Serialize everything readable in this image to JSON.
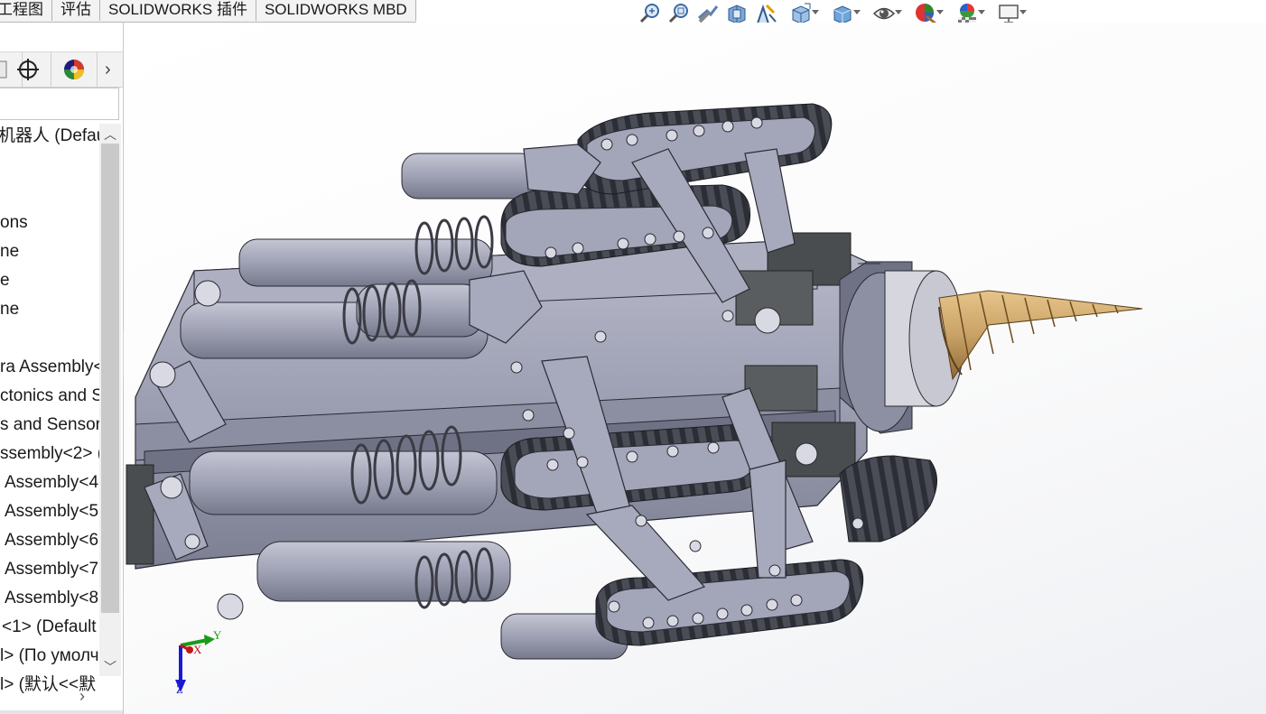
{
  "command_tabs": [
    "工程图",
    "评估",
    "SOLIDWORKS 插件",
    "SOLIDWORKS MBD"
  ],
  "hud_toolbar": {
    "icons": [
      "zoom-to-fit-icon",
      "zoom-to-area-icon",
      "previous-view-icon",
      "section-view-icon",
      "dynamic-annotation-icon",
      "view-orientation-icon",
      "display-style-icon",
      "hide-show-icon",
      "edit-appearance-icon",
      "apply-scene-icon",
      "view-settings-icon"
    ]
  },
  "panel": {
    "tabs": [
      "property-manager-tab",
      "dimxpert-tab",
      "display-manager-tab"
    ],
    "tree_items": [
      "机器人  (Defau",
      "ons",
      "ne",
      "e",
      "ne",
      "ra Assembly<",
      "ctonics and S",
      "s and Sensor",
      "ssembly<2> (",
      "Assembly<4",
      "Assembly<5",
      "Assembly<6",
      "Assembly<7",
      "Assembly<8",
      "<1> (Default",
      "l> (По умолч",
      "l> (默认<<默"
    ]
  },
  "triad": {
    "x_label": "X",
    "y_label": "Y",
    "z_label": "Z"
  },
  "colors": {
    "metal": "#9a9caf",
    "metal_dark": "#6e7085",
    "drill_bit": "#c8a46a",
    "track": "#3a3c46",
    "dark_block": "#4a4d4f"
  }
}
